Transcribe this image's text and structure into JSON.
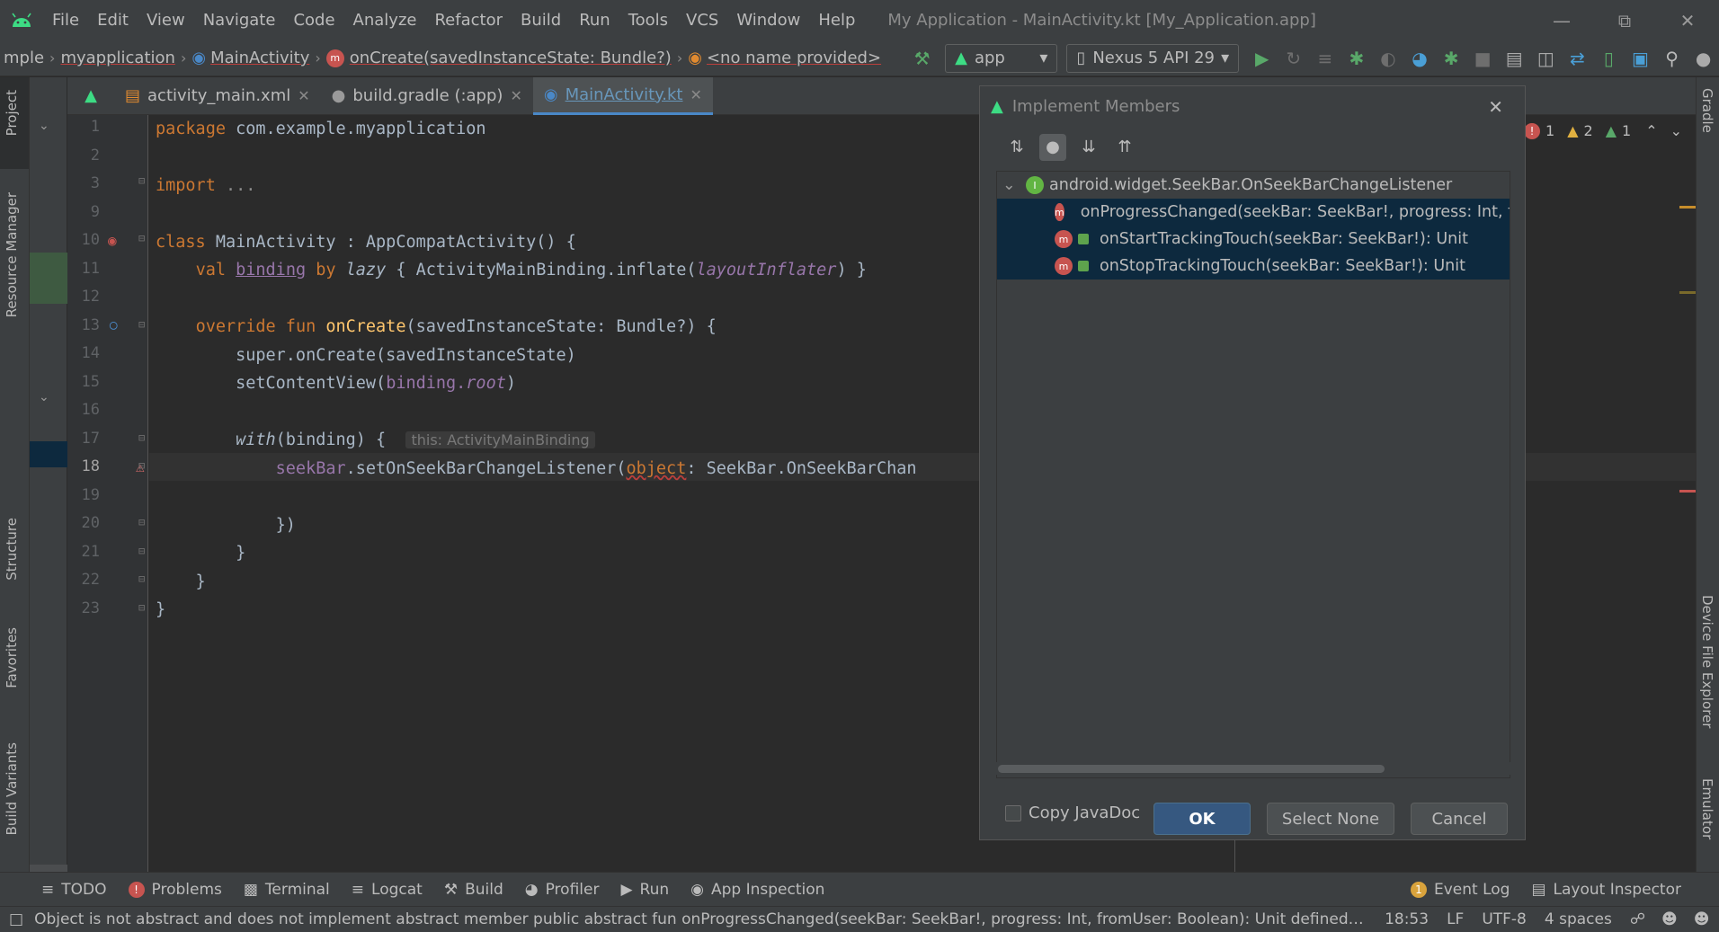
{
  "menu": [
    "File",
    "Edit",
    "View",
    "Navigate",
    "Code",
    "Analyze",
    "Refactor",
    "Build",
    "Run",
    "Tools",
    "VCS",
    "Window",
    "Help"
  ],
  "window_title": "My Application - MainActivity.kt [My_Application.app]",
  "breadcrumbs": {
    "c0": "mple",
    "c1": "myapplication",
    "c2": "MainActivity",
    "c3": "onCreate(savedInstanceState: Bundle?)",
    "c4": "<no name provided>"
  },
  "toolbar": {
    "config": "app",
    "device": "Nexus 5 API 29"
  },
  "tabs": [
    {
      "label": "activity_main.xml"
    },
    {
      "label": "build.gradle (:app)"
    },
    {
      "label": "MainActivity.kt"
    }
  ],
  "left_tools": {
    "project": "Project",
    "resource_manager": "Resource Manager",
    "structure": "Structure",
    "favorites": "Favorites",
    "build_variants": "Build Variants"
  },
  "right_tools": {
    "gradle": "Gradle",
    "device_file_explorer": "Device File Explorer",
    "emulator": "Emulator"
  },
  "inspections": {
    "errors": "1",
    "warnings": "2",
    "weak": "1"
  },
  "line_numbers": [
    "1",
    "2",
    "3",
    "9",
    "10",
    "11",
    "12",
    "13",
    "14",
    "15",
    "16",
    "17",
    "18",
    "19",
    "20",
    "21",
    "22",
    "23"
  ],
  "code": {
    "l1": [
      "package",
      " com.example.myapplication"
    ],
    "l3": [
      "import",
      " ..."
    ],
    "l10": [
      "class",
      " MainActivity : AppCompatActivity() {"
    ],
    "l11": [
      "    ",
      "val",
      " ",
      "binding",
      " ",
      "by",
      " ",
      "lazy",
      " { ActivityMainBinding.inflate(",
      "layoutInflater",
      ") }"
    ],
    "l13": [
      "    ",
      "override fun",
      " ",
      "onCreate",
      "(savedInstanceState: Bundle?) {"
    ],
    "l14": [
      "        super.onCreate(savedInstanceState)"
    ],
    "l15": [
      "        setContentView(",
      "binding.",
      "root",
      ")"
    ],
    "l17": [
      "        ",
      "with",
      "(binding) {  ",
      "this: ActivityMainBinding"
    ],
    "l18": [
      "            ",
      "seekBar",
      ".setOnSeekBarChangeListener(",
      "object",
      ": SeekBar.OnSeekBarChan"
    ],
    "l20": [
      "            })"
    ],
    "l21": [
      "        }"
    ],
    "l22": [
      "    }"
    ],
    "l23": [
      "}"
    ]
  },
  "dialog": {
    "title": "Implement Members",
    "parent": "android.widget.SeekBar.OnSeekBarChangeListener",
    "members": [
      "onProgressChanged(seekBar: SeekBar!, progress: Int, fro",
      "onStartTrackingTouch(seekBar: SeekBar!): Unit",
      "onStopTrackingTouch(seekBar: SeekBar!): Unit"
    ],
    "copy_javadoc": "Copy JavaDoc",
    "ok": "OK",
    "select_none": "Select None",
    "cancel": "Cancel"
  },
  "bottom_tools": [
    "TODO",
    "Problems",
    "Terminal",
    "Logcat",
    "Build",
    "Profiler",
    "Run",
    "App Inspection"
  ],
  "bottom_right": {
    "event_log": "Event Log",
    "event_count": "1",
    "layout_inspector": "Layout Inspector"
  },
  "status": {
    "message": "Object is not abstract and does not implement abstract member public abstract fun onProgressChanged(seekBar: SeekBar!, progress: Int, fromUser: Boolean): Unit defined in andr...",
    "position": "18:53",
    "line_sep": "LF",
    "encoding": "UTF-8",
    "indent": "4 spaces"
  }
}
